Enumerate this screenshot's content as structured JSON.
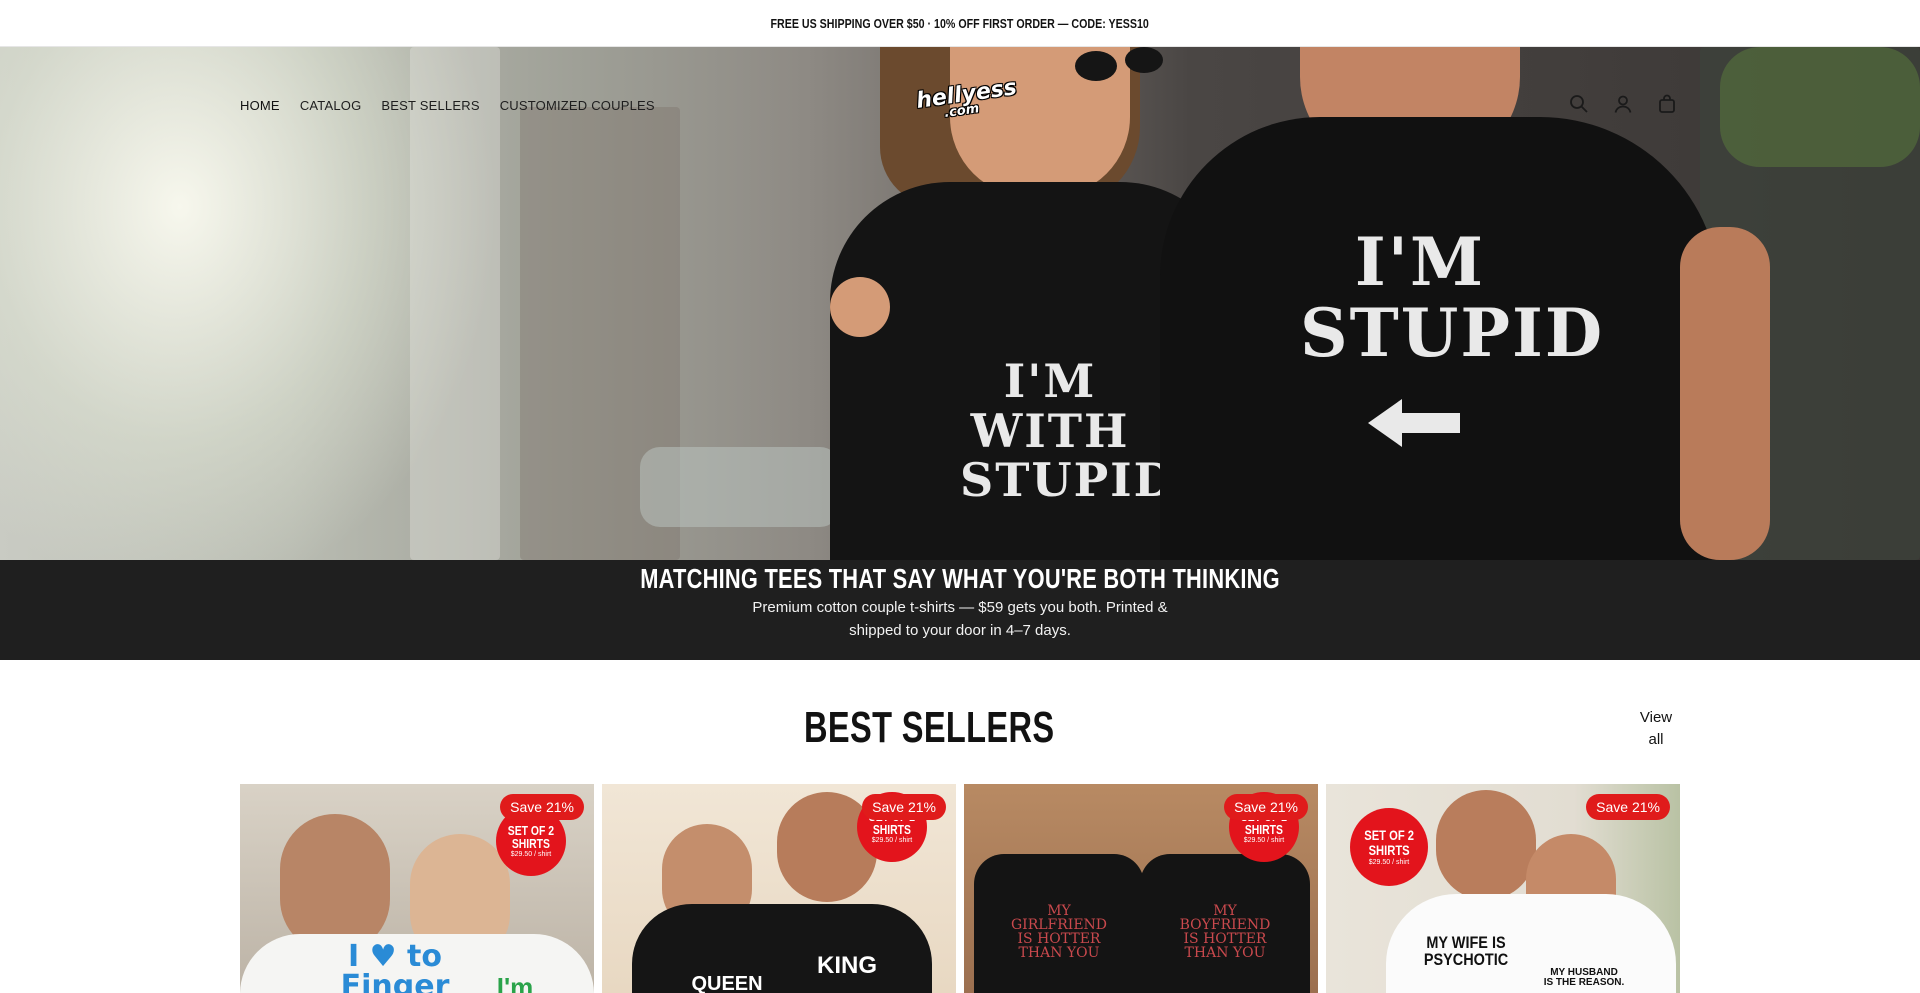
{
  "announcement": {
    "text": "FREE US SHIPPING OVER $50 · 10% OFF FIRST ORDER — CODE: YESS10"
  },
  "header": {
    "nav": [
      {
        "label": "HOME"
      },
      {
        "label": "CATALOG"
      },
      {
        "label": "BEST SELLERS"
      },
      {
        "label": "CUSTOMIZED COUPLES"
      }
    ],
    "logo": {
      "main": "hellyess",
      "sub": ".com"
    },
    "icons": [
      "search-icon",
      "account-icon",
      "cart-icon"
    ]
  },
  "hero": {
    "shirt_left_text": "I'M\nWITH\nSTUPID",
    "shirt_right_text": "I'M\nSTUPID"
  },
  "banner": {
    "heading": "MATCHING TEES THAT SAY WHAT YOU'RE BOTH THINKING",
    "subtext": "Premium cotton couple t-shirts — $59 gets you both. Printed & shipped to your door in 4–7 days."
  },
  "best_sellers": {
    "title": "BEST SELLERS",
    "view_all": "View all",
    "products": [
      {
        "badge": "Save 21%",
        "seal_title": "SET OF 2\nSHIRTS",
        "seal_price": "$29.50 / shirt",
        "print_left": "I ♥ to\nFinger",
        "print_right": "I'm"
      },
      {
        "badge": "Save 21%",
        "seal_title": "SET OF 2\nSHIRTS",
        "seal_price": "$29.50 / shirt",
        "print_left": "QUEEN",
        "print_right": "KING"
      },
      {
        "badge": "Save 21%",
        "seal_title": "SET OF 2\nSHIRTS",
        "seal_price": "$29.50 / shirt",
        "print_left": "MY\nGIRLFRIEND\nIS HOTTER\nTHAN YOU",
        "print_right": "MY\nBOYFRIEND\nIS HOTTER\nTHAN YOU"
      },
      {
        "badge": "Save 21%",
        "seal_title": "SET OF 2\nSHIRTS",
        "seal_price": "$29.50 / shirt",
        "print_left": "MY WIFE IS\nPSYCHOTIC",
        "print_right": "MY HUSBAND\nIS THE REASON."
      }
    ]
  },
  "colors": {
    "sale_red": "#e01b1b",
    "banner_bg": "#1f1f1f"
  }
}
